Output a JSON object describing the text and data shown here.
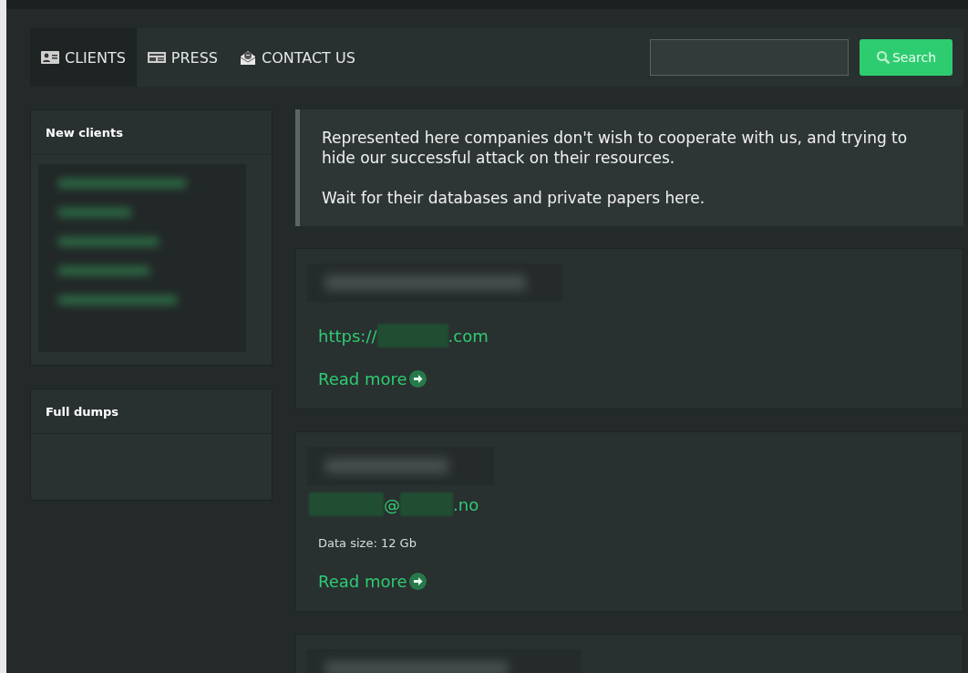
{
  "nav": {
    "tabs": [
      {
        "label": "CLIENTS",
        "selected": true
      },
      {
        "label": "PRESS",
        "selected": false
      },
      {
        "label": "CONTACT US",
        "selected": false
      }
    ],
    "search": {
      "button": "Search"
    }
  },
  "sidebar": [
    {
      "title": "New clients",
      "redacted": true
    },
    {
      "title": "Full dumps",
      "redacted": false
    }
  ],
  "notice": [
    "Represented here companies don't wish to cooperate with us, and trying to hide our successful attack on their resources.",
    "Wait for their databases and private papers here."
  ],
  "posts": [
    {
      "kind": "url",
      "contact_prefix": "https://",
      "contact_suffix": ".com",
      "read_more": "Read more"
    },
    {
      "kind": "email",
      "contact_at": "@",
      "contact_suffix": ".no",
      "data_size": "Data size: 12 Gb",
      "read_more": "Read more"
    },
    {
      "kind": "cut"
    }
  ]
}
